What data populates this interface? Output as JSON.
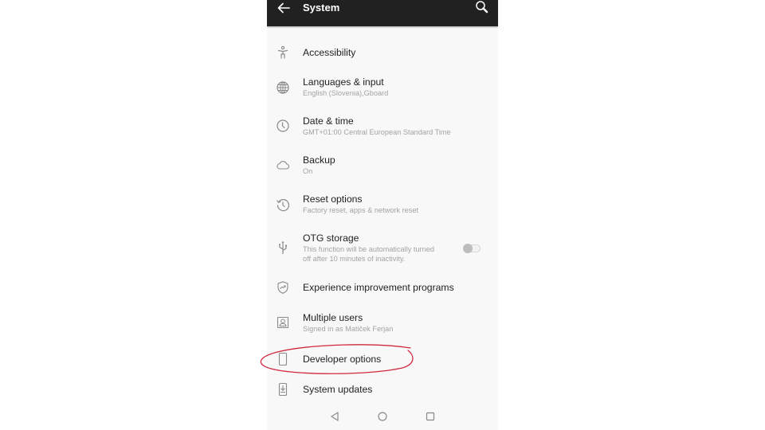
{
  "app_bar": {
    "title": "System",
    "back_icon": "arrow-back-icon",
    "search_icon": "search-icon"
  },
  "items": [
    {
      "label": "Accessibility",
      "summary": "",
      "icon": "accessibility-icon"
    },
    {
      "label": "Languages & input",
      "summary": "English (Slovenia),Gboard",
      "icon": "globe-icon"
    },
    {
      "label": "Date & time",
      "summary": "GMT+01:00 Central European Standard Time",
      "icon": "clock-icon"
    },
    {
      "label": "Backup",
      "summary": "On",
      "icon": "cloud-icon"
    },
    {
      "label": "Reset options",
      "summary": "Factory reset, apps & network reset",
      "icon": "history-icon"
    },
    {
      "label": "OTG storage",
      "summary_line1": "This function will be automatically turned",
      "summary_line2": "off after 10 minutes of inactivity.",
      "icon": "usb-icon",
      "toggle": "off"
    },
    {
      "label": "Experience improvement programs",
      "summary": "",
      "icon": "shield-trending-icon"
    },
    {
      "label": "Multiple users",
      "summary": "Signed in as Matiček Ferjan",
      "icon": "user-box-icon"
    },
    {
      "label": "Developer options",
      "summary": "",
      "icon": "phone-outline-icon"
    },
    {
      "label": "System updates",
      "summary": "",
      "icon": "system-update-icon"
    }
  ],
  "navbar": {
    "back": "nav-back-icon",
    "home": "nav-home-icon",
    "recents": "nav-recents-icon"
  },
  "annotation": {
    "type": "hand-drawn ellipse",
    "target": "Developer options",
    "color": "#d0283c"
  },
  "colors": {
    "app_bar": "#212121",
    "background": "#f8f8f8",
    "primary_text": "#1f1f1f",
    "secondary_text": "#a3a3a3",
    "icon": "#8a8a8a"
  }
}
